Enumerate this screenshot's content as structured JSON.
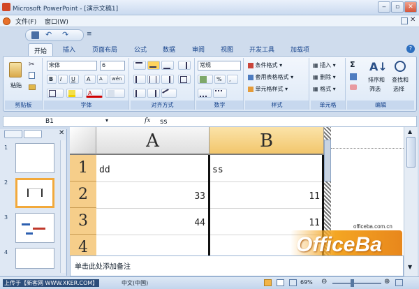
{
  "window": {
    "title": "Microsoft PowerPoint - [演示文稿1]"
  },
  "menu": {
    "file": "文件(F)",
    "window": "窗口(W)"
  },
  "tabs": [
    "开始",
    "插入",
    "页面布局",
    "公式",
    "数据",
    "审阅",
    "视图",
    "开发工具",
    "加载项"
  ],
  "ribbon": {
    "clipboard": {
      "paste": "粘贴",
      "label": "剪贴板"
    },
    "font": {
      "name": "宋体",
      "size": "6",
      "bold": "B",
      "italic": "I",
      "underline": "U",
      "grow": "A",
      "shrink": "A",
      "wen": "wén",
      "color_a": "A",
      "label": "字体"
    },
    "alignment": {
      "label": "对齐方式"
    },
    "number": {
      "format": "常规",
      "percent": "%",
      "comma": ",",
      "label": "数字"
    },
    "styles": {
      "conditional": "条件格式",
      "table": "套用表格格式",
      "cell": "单元格样式",
      "label": "样式"
    },
    "cells": {
      "insert": "插入",
      "delete": "删除",
      "format": "格式",
      "label": "单元格"
    },
    "editing": {
      "sigma": "Σ",
      "sort": "排序和",
      "filter": "筛选",
      "find": "查找和",
      "select": "选择",
      "label": "编辑"
    }
  },
  "formula_bar": {
    "name_box": "B1",
    "fx": "fx",
    "value": "ss"
  },
  "slides": [
    "1",
    "2",
    "3",
    "4"
  ],
  "sheet": {
    "columns": [
      "A",
      "B"
    ],
    "rows": [
      {
        "num": "1",
        "a": "dd",
        "b": "ss"
      },
      {
        "num": "2",
        "a": "33",
        "b": "11"
      },
      {
        "num": "3",
        "a": "44",
        "b": "11"
      },
      {
        "num": "4",
        "a": "",
        "b": ""
      }
    ]
  },
  "notes": {
    "placeholder": "单击此处添加备注"
  },
  "status": {
    "left": "上传于【新客网 WWW.XKER.COM】",
    "lang": "中文(中国)",
    "zoom": "69%"
  },
  "watermark": {
    "url": "officeba.com.cn",
    "brand": "OfficeBa"
  },
  "colors": {
    "accent": "#15428b",
    "row_header": "#f6ce8a",
    "ribbon": "#dce8f6"
  }
}
